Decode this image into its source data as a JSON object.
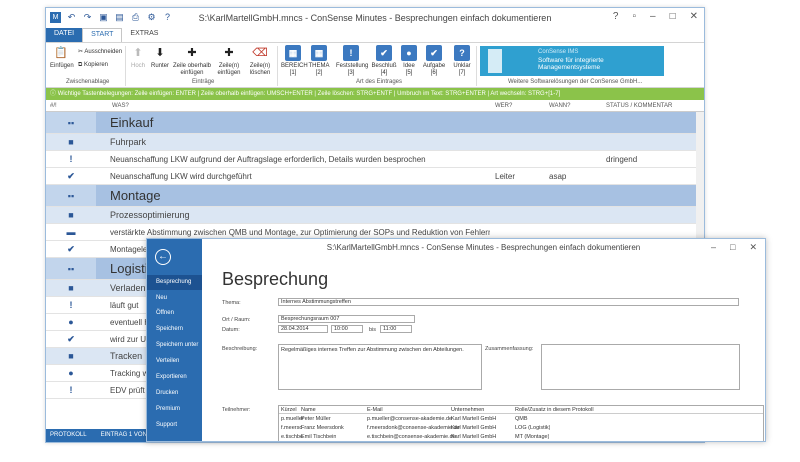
{
  "win1": {
    "title": "S:\\KarlMartellGmbH.mncs - ConSense Minutes - Besprechungen einfach dokumentieren",
    "app_icon": "M",
    "tabs": [
      "DATEI",
      "START",
      "EXTRAS"
    ],
    "ribbon": {
      "buttons": [
        {
          "icon": "paste-icon",
          "label": "Einfügen"
        },
        {
          "icon": "cut-icon",
          "label": "Ausschneiden"
        },
        {
          "icon": "copy-icon",
          "label": "Kopieren"
        },
        {
          "icon": "arrow-up-icon",
          "label": "Hoch"
        },
        {
          "icon": "arrow-down-icon",
          "label": "Runter"
        },
        {
          "icon": "plus-icon",
          "label": "Zeile oberhalb einfügen"
        },
        {
          "icon": "plus-icon",
          "label": "Zeile(n) einfügen"
        },
        {
          "icon": "delete-icon",
          "label": "Zeile(n) löschen"
        },
        {
          "icon": "grid-icon",
          "label": "BEREICH [1]"
        },
        {
          "icon": "grid-icon",
          "label": "THEMA [2]"
        },
        {
          "icon": "exclamation-icon",
          "label": "Feststellung [3]"
        },
        {
          "icon": "check-icon",
          "label": "Beschluß [4]"
        },
        {
          "icon": "bulb-icon",
          "label": "Idee [5]"
        },
        {
          "icon": "check-icon",
          "label": "Aufgabe [6]"
        },
        {
          "icon": "question-icon",
          "label": "Unklar [7]"
        }
      ],
      "groups": [
        "Zwischenablage",
        "Einträge",
        "Art des Eintrages",
        "Weitere Softwarelösungen der ConSense GmbH..."
      ],
      "promo_title": "ConSense IMS",
      "promo_text": "Software für integrierte Managementsysteme"
    },
    "infobar": "Wichtige Tastenbelegungen: Zeile einfügen: ENTER | Zeile oberhalb einfügen: UMSCH+ENTER | Zeile löschen: STRG+ENTF | Umbruch im Text: STRG+ENTER | Art wechseln: STRG+[1-7]",
    "columns": [
      "#/!",
      "WAS?",
      "WER?",
      "WANN?",
      "STATUS / KOMMENTAR"
    ],
    "rows": [
      {
        "kind": "h1",
        "marker": "▪▪",
        "text": "Einkauf",
        "who": "",
        "when": "",
        "status": ""
      },
      {
        "kind": "h2",
        "marker": "■",
        "text": "Fuhrpark",
        "who": "",
        "when": "",
        "status": ""
      },
      {
        "kind": "it",
        "marker": "!",
        "text": "Neuanschaffung LKW aufgrund der Auftragslage erforderlich, Details wurden besprochen",
        "who": "",
        "when": "",
        "status": "dringend"
      },
      {
        "kind": "it",
        "marker": "✔",
        "text": "Neuanschaffung LKW wird durchgeführt",
        "who": "Leiter",
        "when": "asap",
        "status": ""
      },
      {
        "kind": "h1",
        "marker": "▪▪",
        "text": "Montage",
        "who": "",
        "when": "",
        "status": ""
      },
      {
        "kind": "h2",
        "marker": "■",
        "text": "Prozessoptimierung",
        "who": "",
        "when": "",
        "status": ""
      },
      {
        "kind": "it",
        "marker": "▬",
        "text": "verstärkte Abstimmung zwischen QMB und Montage, zur Optimierung der SOPs und Reduktion von Fehlern",
        "who": "",
        "when": "",
        "status": ""
      },
      {
        "kind": "it",
        "marker": "✔",
        "text": "Montageleitung",
        "who": "",
        "when": "",
        "status": ""
      },
      {
        "kind": "h1",
        "marker": "▪▪",
        "text": "Logistik",
        "who": "",
        "when": "",
        "status": ""
      },
      {
        "kind": "h2",
        "marker": "■",
        "text": "Verladen",
        "who": "",
        "when": "",
        "status": ""
      },
      {
        "kind": "it",
        "marker": "!",
        "text": "läuft gut",
        "who": "",
        "when": "",
        "status": ""
      },
      {
        "kind": "it",
        "marker": "●",
        "text": "eventuell H",
        "who": "",
        "when": "",
        "status": ""
      },
      {
        "kind": "it",
        "marker": "✔",
        "text": "wird zur U",
        "who": "",
        "when": "",
        "status": ""
      },
      {
        "kind": "h2",
        "marker": "■",
        "text": "Tracken",
        "who": "",
        "when": "",
        "status": ""
      },
      {
        "kind": "it",
        "marker": "●",
        "text": "Tracking w",
        "who": "",
        "when": "",
        "status": ""
      },
      {
        "kind": "it",
        "marker": "!",
        "text": "EDV prüft",
        "who": "",
        "when": "",
        "status": ""
      }
    ],
    "statusbar": [
      "PROTOKOLL",
      "EINTRAG 1 VON 16",
      "BI"
    ]
  },
  "win2": {
    "title": "S:\\KarlMartellGmbH.mncs - ConSense Minutes - Besprechungen einfach dokumentieren",
    "menu": [
      "Besprechung",
      "Neu",
      "Öffnen",
      "Speichern",
      "Speichern unter",
      "Verteilen",
      "Exportieren",
      "Drucken",
      "Premium",
      "Support"
    ],
    "heading": "Besprechung",
    "fields": {
      "thema_label": "Thema:",
      "thema_value": "Internes Abstimmungstreffen",
      "ort_label": "Ort / Raum:",
      "ort_value": "Besprechungsraum 007",
      "datum_label": "Datum:",
      "datum_value": "28.04.2014",
      "von_value": "10:00",
      "bis_label": "bis",
      "bis_value": "11:00",
      "beschreibung_label": "Beschreibung:",
      "beschreibung_value": "Regelmäßiges internes Treffen zur Abstimmung zwischen den Abteilungen.",
      "zusammenfassung_label": "Zusammenfassung:",
      "teilnehmer_label": "Teilnehmer:"
    },
    "participants": {
      "headers": [
        "Kürzel",
        "Name",
        "E-Mail",
        "Unternehmen",
        "Rolle/Zusatz in diesem Protokoll"
      ],
      "rows": [
        [
          "p.mueller",
          "Peter Müller",
          "p.mueller@consense-akademie.de",
          "Karl Martell GmbH",
          "QMB"
        ],
        [
          "f.meersd",
          "Franz Meersdonk",
          "f.meersdonk@consense-akademie.de",
          "Karl Martell GmbH",
          "LOG (Logistik)"
        ],
        [
          "e.tischbe",
          "Emil Tischbein",
          "e.tischbein@consense-akademie.de",
          "Karl Martell GmbH",
          "MT (Montage)"
        ]
      ]
    }
  }
}
